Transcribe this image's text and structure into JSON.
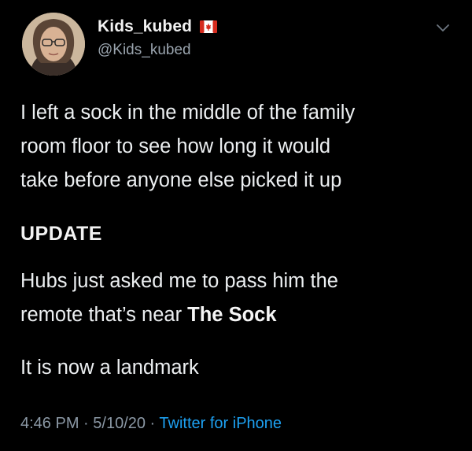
{
  "author": {
    "display_name": "Kids_kubed",
    "handle": "@Kids_kubed",
    "badge_icon": "canada-flag-icon",
    "avatar_icon": "profile-photo"
  },
  "menu_icon": "chevron-down-icon",
  "tweet": {
    "line1": "I left a sock in the middle of the family",
    "line2": "room floor to see how long it would",
    "line3": "take before anyone else picked it up",
    "update_heading": "UPDATE",
    "line4": "Hubs just asked me to pass him the",
    "line5_prefix": "remote that’s near ",
    "line5_bold": "The Sock",
    "line6": "It is now a landmark"
  },
  "meta": {
    "time": "4:46 PM",
    "separator": " · ",
    "date": "5/10/20",
    "source": "Twitter for iPhone"
  },
  "colors": {
    "background": "#000000",
    "text": "#eceff1",
    "secondary": "#8b98a5",
    "link": "#1da1f2",
    "flag_red": "#d52b1e"
  }
}
